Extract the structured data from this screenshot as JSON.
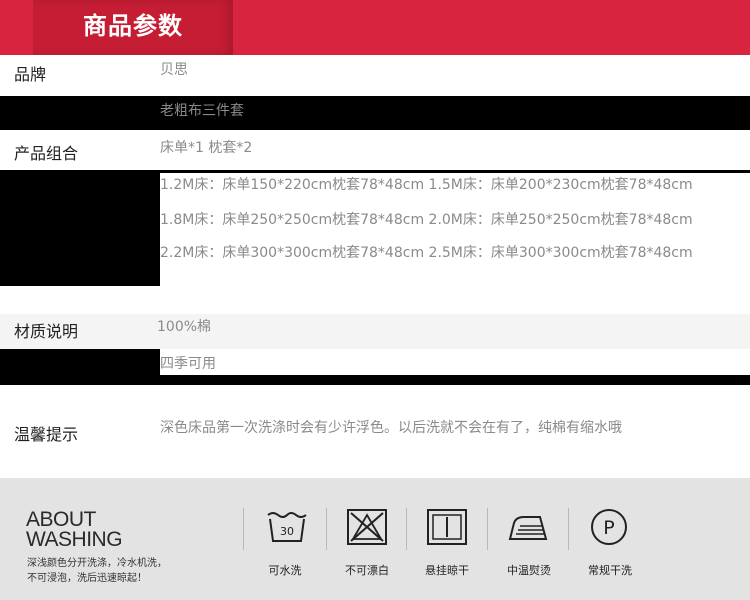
{
  "header": {
    "title": "商品参数"
  },
  "params": [
    {
      "label": "品牌",
      "value": "贝思"
    },
    {
      "label": "",
      "value": "老粗布三件套"
    },
    {
      "label": "产品组合",
      "value": "床单*1  枕套*2"
    },
    {
      "label": "",
      "lines": [
        "1.2M床：床单150*220cm枕套78*48cm  1.5M床：床单200*230cm枕套78*48cm",
        "1.8M床：床单250*250cm枕套78*48cm  2.0M床：床单250*250cm枕套78*48cm",
        "2.2M床：床单300*300cm枕套78*48cm 2.5M床：床单300*300cm枕套78*48cm"
      ]
    },
    {
      "label": "材质说明",
      "value": "100%棉"
    },
    {
      "label": "",
      "value": "四季可用"
    },
    {
      "label": "温馨提示",
      "value": "深色床品第一次洗涤时会有少许浮色。以后洗就不会在有了，纯棉有缩水哦"
    }
  ],
  "washing": {
    "title_line1": "ABOUT",
    "title_line2": "WASHING",
    "desc_line1": "深浅颜色分开洗涤，冷水机洗，",
    "desc_line2": "不可浸泡，洗后迅速晾起！",
    "icons": [
      {
        "icon": "hand-wash-30-icon",
        "label": "可水洗",
        "mark": "30"
      },
      {
        "icon": "no-bleach-icon",
        "label": "不可漂白"
      },
      {
        "icon": "hang-dry-icon",
        "label": "悬挂晾干"
      },
      {
        "icon": "iron-medium-icon",
        "label": "中温熨烫"
      },
      {
        "icon": "dry-clean-icon",
        "label": "常规干洗",
        "mark": "P"
      }
    ]
  }
}
